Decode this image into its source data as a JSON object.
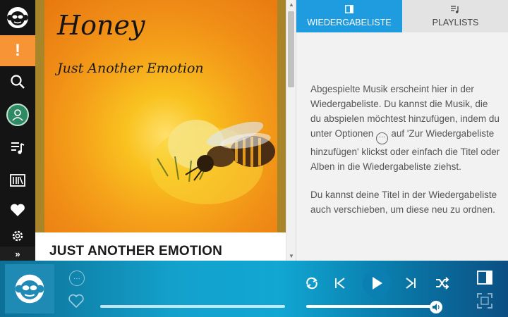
{
  "sidebar": {
    "items": [
      {
        "icon": "napster-logo-icon"
      },
      {
        "icon": "alert-icon",
        "label": "!"
      },
      {
        "icon": "search-icon"
      },
      {
        "icon": "profile-icon"
      },
      {
        "icon": "playlist-icon"
      },
      {
        "icon": "library-icon"
      },
      {
        "icon": "heart-icon"
      },
      {
        "icon": "gear-icon"
      },
      {
        "icon": "expand-icon",
        "label": "»"
      }
    ],
    "accent": "#f79435"
  },
  "album": {
    "cover_title": "Honey",
    "cover_subtitle": "Just Another Emotion",
    "title": "JUST ANOTHER EMOTION"
  },
  "panel": {
    "tabs": [
      {
        "label": "WIEDERGABELISTE",
        "icon": "queue-icon",
        "active": true
      },
      {
        "label": "PLAYLISTS",
        "icon": "playlist-icon",
        "active": false
      }
    ],
    "paragraph1_part1": "Abgespielte Musik erscheint hier in der Wiedergabeliste. Du kannst die Musik, die du abspielen möchtest hinzufügen, indem du unter Optionen",
    "paragraph1_part2": "auf 'Zur Wiedergabeliste hinzufügen' klickst oder einfach die Titel oder Alben in die Wiedergabeliste ziehst.",
    "paragraph2": "Du kannst deine Titel in der Wiedergabeliste auch verschieben, um diese neu zu ordnen.",
    "accent": "#1f9ce0"
  },
  "player": {
    "more_label": "···",
    "progress": 0,
    "volume": 0.96,
    "controls": [
      "repeat-icon",
      "previous-icon",
      "play-icon",
      "next-icon",
      "shuffle-icon",
      "queue-icon",
      "fullscreen-icon"
    ]
  }
}
